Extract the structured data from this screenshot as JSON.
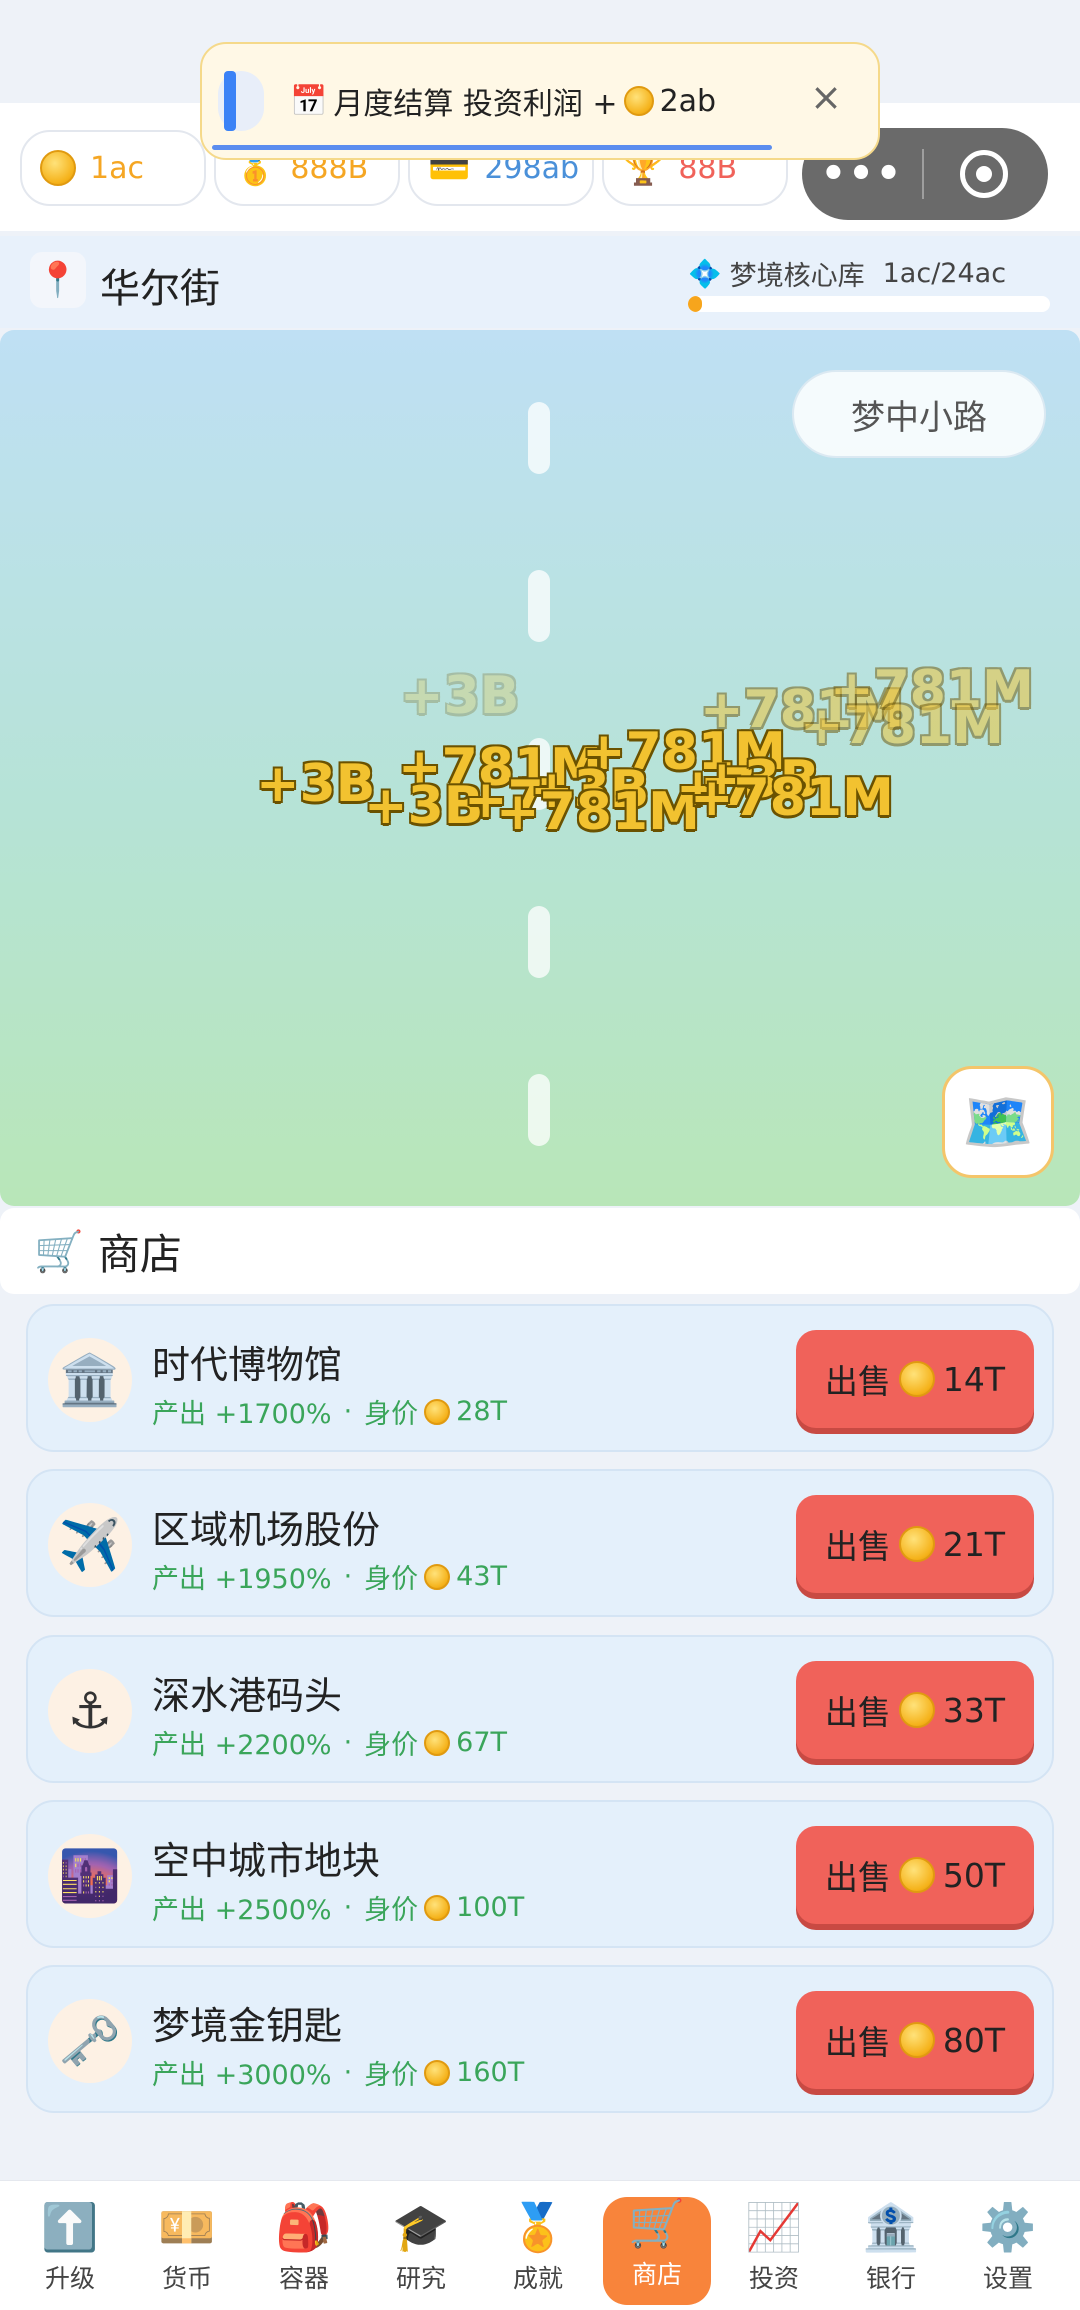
{
  "stats": [
    {
      "name": "coins",
      "icon": "coin-icon",
      "value": "1ac",
      "color": "#f5a623"
    },
    {
      "name": "gold-medal",
      "icon": "medal-icon",
      "value": "888B",
      "color": "#f5a623"
    },
    {
      "name": "card",
      "icon": "card-icon",
      "value": "298ab",
      "color": "#4a90d9"
    },
    {
      "name": "trophy",
      "icon": "trophy-icon",
      "value": "88B",
      "color": "#f0625a"
    }
  ],
  "toast": {
    "text": "月度结算 投资利润 +",
    "amount": "2ab",
    "close": "×"
  },
  "capsule": {
    "dots": "•••"
  },
  "location": {
    "name": "华尔街",
    "vault_label": "梦境核心库",
    "vault_value": "1ac/24ac",
    "vault_progress": 0.04
  },
  "scene": {
    "tag": "梦中小路",
    "map_icon": "🗺️",
    "floats": [
      {
        "text": "+3B",
        "style": "faded"
      },
      {
        "text": "+781M",
        "style": "semi"
      },
      {
        "text": "+781M",
        "style": "semi"
      },
      {
        "text": "+781M",
        "style": "semi"
      },
      {
        "text": "+3B",
        "style": "solid"
      },
      {
        "text": "+781M",
        "style": "solid"
      },
      {
        "text": "+781M",
        "style": "solid"
      },
      {
        "text": "+3B",
        "style": "solid"
      },
      {
        "text": "+7",
        "style": "solid"
      },
      {
        "text": "+3B",
        "style": "solid"
      },
      {
        "text": "+781M",
        "style": "solid"
      },
      {
        "text": "+7",
        "style": "solid"
      },
      {
        "text": "+3B",
        "style": "solid"
      },
      {
        "text": "+781M",
        "style": "solid"
      }
    ]
  },
  "shop": {
    "title": "商店",
    "items": [
      {
        "name": "时代博物馆",
        "icon": "🏛️",
        "output": "产出 +1700%",
        "sep": "·",
        "worth_label": "身价",
        "worth": "28T",
        "sell_label": "出售",
        "price": "14T"
      },
      {
        "name": "区域机场股份",
        "icon": "✈️",
        "output": "产出 +1950%",
        "sep": "·",
        "worth_label": "身价",
        "worth": "43T",
        "sell_label": "出售",
        "price": "21T"
      },
      {
        "name": "深水港码头",
        "icon": "⚓",
        "output": "产出 +2200%",
        "sep": "·",
        "worth_label": "身价",
        "worth": "67T",
        "sell_label": "出售",
        "price": "33T"
      },
      {
        "name": "空中城市地块",
        "icon": "🌆",
        "output": "产出 +2500%",
        "sep": "·",
        "worth_label": "身价",
        "worth": "100T",
        "sell_label": "出售",
        "price": "50T"
      },
      {
        "name": "梦境金钥匙",
        "icon": "🗝️",
        "output": "产出 +3000%",
        "sep": "·",
        "worth_label": "身价",
        "worth": "160T",
        "sell_label": "出售",
        "price": "80T"
      }
    ]
  },
  "nav": [
    {
      "label": "升级",
      "icon": "⬆️"
    },
    {
      "label": "货币",
      "icon": "💴"
    },
    {
      "label": "容器",
      "icon": "🎒"
    },
    {
      "label": "研究",
      "icon": "🎓"
    },
    {
      "label": "成就",
      "icon": "🏅"
    },
    {
      "label": "商店",
      "icon": "🛒",
      "active": true
    },
    {
      "label": "投资",
      "icon": "📈"
    },
    {
      "label": "银行",
      "icon": "🏦"
    },
    {
      "label": "设置",
      "icon": "⚙️"
    }
  ]
}
